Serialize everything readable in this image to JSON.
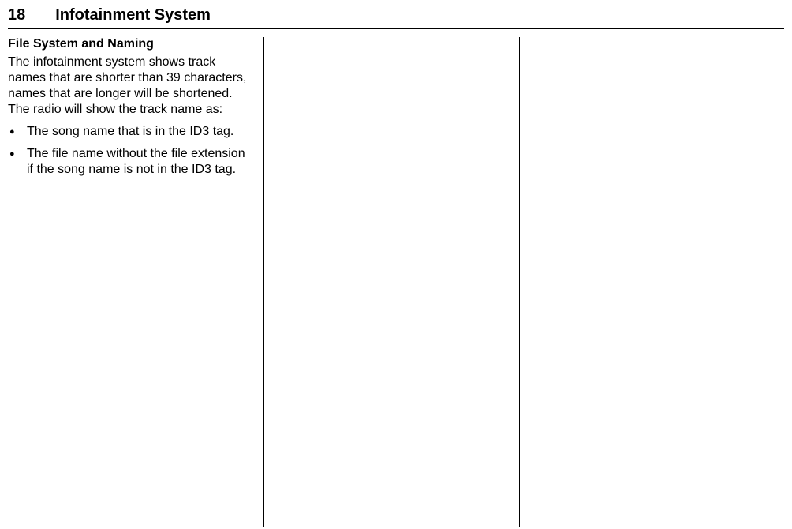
{
  "header": {
    "page_number": "18",
    "title": "Infotainment System"
  },
  "column1": {
    "section_heading": "File System and Naming",
    "paragraph": "The infotainment system shows track names that are shorter than 39 characters, names that are longer will be shortened. The radio will show the track name as:",
    "bullets": [
      "The song name that is in the ID3 tag.",
      "The file name without the file extension if the song name is not in the ID3 tag."
    ]
  }
}
